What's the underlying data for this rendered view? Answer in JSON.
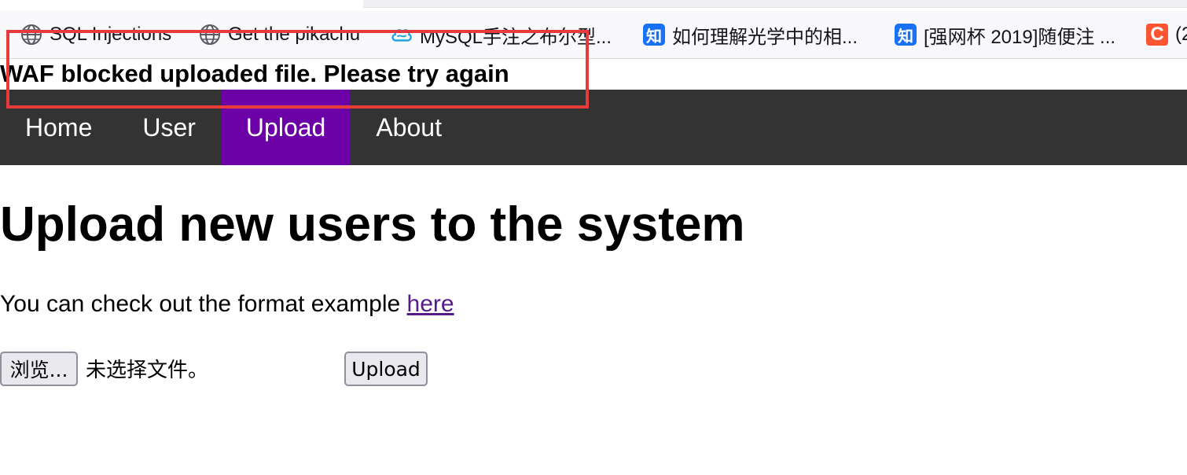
{
  "bookmarks": [
    {
      "label": "SQL Injections",
      "icon": "globe-icon"
    },
    {
      "label": "Get the pikachu",
      "icon": "globe-icon"
    },
    {
      "label": "MySQL手注之布尔型...",
      "icon": "cloud-icon"
    },
    {
      "label": "如何理解光学中的相...",
      "icon": "zhihu-icon",
      "glyph": "知"
    },
    {
      "label": "[强网杯 2019]随便注 ...",
      "icon": "zhihu-icon",
      "glyph": "知"
    },
    {
      "label": "(2",
      "icon": "csdn-icon",
      "glyph": "C"
    }
  ],
  "waf_message": "WAF blocked uploaded file. Please try again",
  "nav": {
    "items": [
      "Home",
      "User",
      "Upload",
      "About"
    ],
    "active": "Upload"
  },
  "main": {
    "title": "Upload new users to the system",
    "example_text": "You can check out the format example ",
    "example_link": "here",
    "browse_label": "浏览...",
    "no_file_text": "未选择文件。",
    "upload_label": "Upload"
  },
  "colors": {
    "nav_bg": "#333333",
    "nav_active": "#6a00a6",
    "annotation": "#e8393c",
    "link": "#551a8b"
  }
}
